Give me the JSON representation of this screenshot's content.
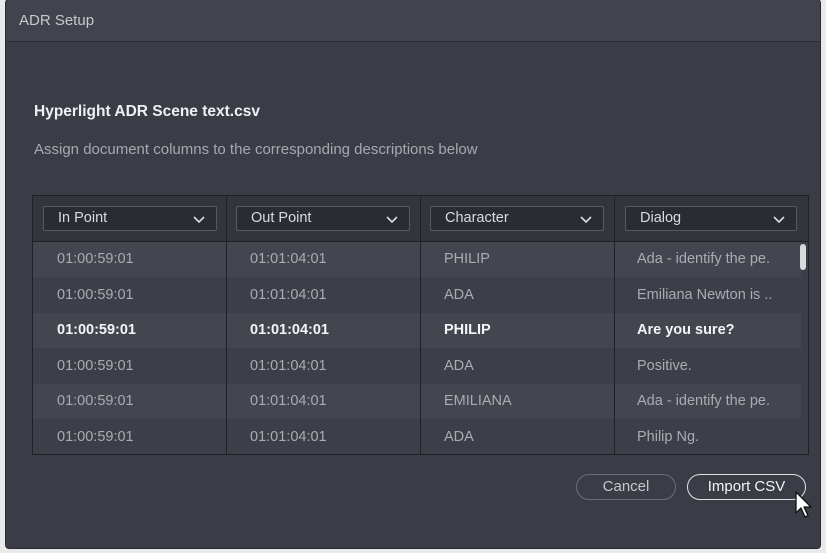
{
  "window": {
    "title": "ADR Setup"
  },
  "file": {
    "name": "Hyperlight ADR Scene text.csv"
  },
  "instructions": "Assign document columns to the corresponding descriptions below",
  "columns": [
    {
      "label": "In Point"
    },
    {
      "label": "Out Point"
    },
    {
      "label": "Character"
    },
    {
      "label": "Dialog"
    }
  ],
  "rows": [
    {
      "in": "01:00:59:01",
      "out": "01:01:04:01",
      "character": "PHILIP",
      "dialog": "Ada - identify the pe.",
      "selected": false
    },
    {
      "in": "01:00:59:01",
      "out": "01:01:04:01",
      "character": "ADA",
      "dialog": "Emiliana Newton is ..",
      "selected": false
    },
    {
      "in": "01:00:59:01",
      "out": "01:01:04:01",
      "character": "PHILIP",
      "dialog": "Are you sure?",
      "selected": true
    },
    {
      "in": "01:00:59:01",
      "out": "01:01:04:01",
      "character": "ADA",
      "dialog": "Positive.",
      "selected": false
    },
    {
      "in": "01:00:59:01",
      "out": "01:01:04:01",
      "character": "EMILIANA",
      "dialog": "Ada - identify the pe.",
      "selected": false
    },
    {
      "in": "01:00:59:01",
      "out": "01:01:04:01",
      "character": "ADA",
      "dialog": "Philip Ng.",
      "selected": false
    }
  ],
  "buttons": {
    "cancel": "Cancel",
    "import": "Import CSV"
  },
  "colors": {
    "dialog_bg": "#3a3d45",
    "selected_text": "#f4f5f7",
    "muted_text": "#a9acb2"
  },
  "icons": {
    "dropdown": "chevron-down-icon",
    "cursor": "mouse-pointer-icon"
  }
}
